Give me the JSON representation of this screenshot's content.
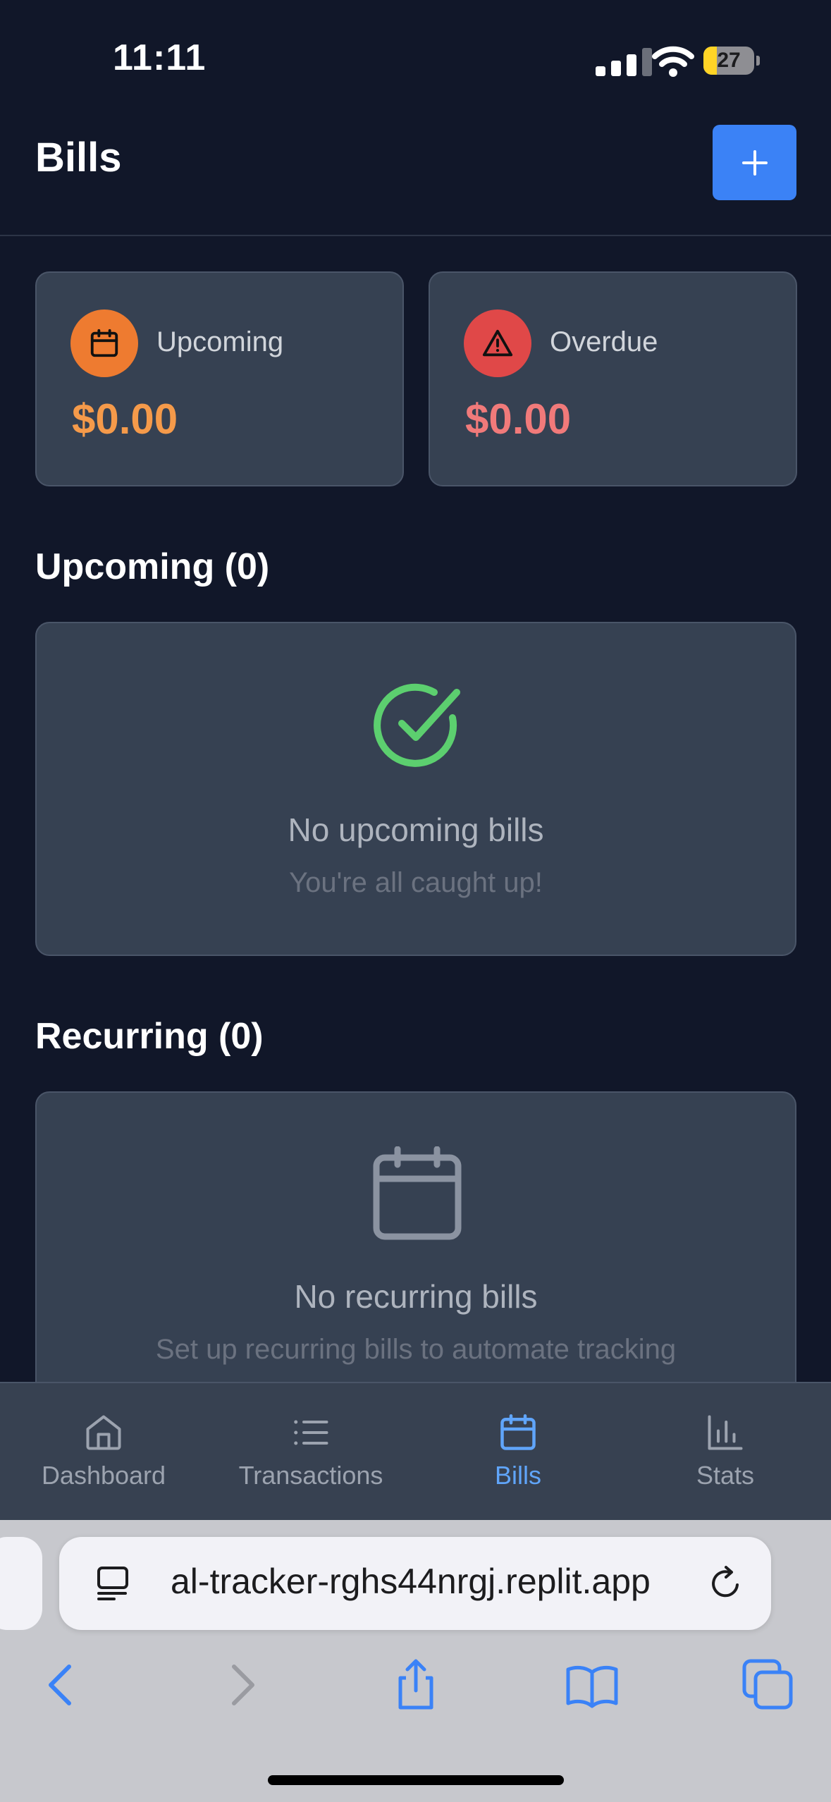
{
  "status_bar": {
    "time": "11:11",
    "battery_level": "27",
    "battery_fraction": 0.27
  },
  "header": {
    "title": "Bills",
    "add_label": "+"
  },
  "summary": {
    "upcoming": {
      "label": "Upcoming",
      "amount": "$0.00",
      "icon": "calendar-icon",
      "color": "#ee7b30",
      "amount_color": "#f59a4a"
    },
    "overdue": {
      "label": "Overdue",
      "amount": "$0.00",
      "icon": "warning-triangle-icon",
      "color": "#e04848",
      "amount_color": "#f17a7a"
    }
  },
  "upcoming_section": {
    "heading": "Upcoming (0)",
    "empty_title": "No upcoming bills",
    "empty_subtitle": "You're all caught up!",
    "icon": "check-circle-icon",
    "icon_color": "#5ccf6f"
  },
  "recurring_section": {
    "heading": "Recurring (0)",
    "empty_title": "No recurring bills",
    "empty_subtitle": "Set up recurring bills to automate tracking",
    "icon": "calendar-icon"
  },
  "tabbar": {
    "active_color": "#60a5fa",
    "items": [
      {
        "label": "Dashboard",
        "icon": "home-icon",
        "active": false
      },
      {
        "label": "Transactions",
        "icon": "list-icon",
        "active": false
      },
      {
        "label": "Bills",
        "icon": "calendar-icon",
        "active": true
      },
      {
        "label": "Stats",
        "icon": "bar-chart-icon",
        "active": false
      }
    ]
  },
  "browser": {
    "url": "al-tracker-rghs44nrgj.replit.app",
    "accent": "#3a82f7"
  }
}
